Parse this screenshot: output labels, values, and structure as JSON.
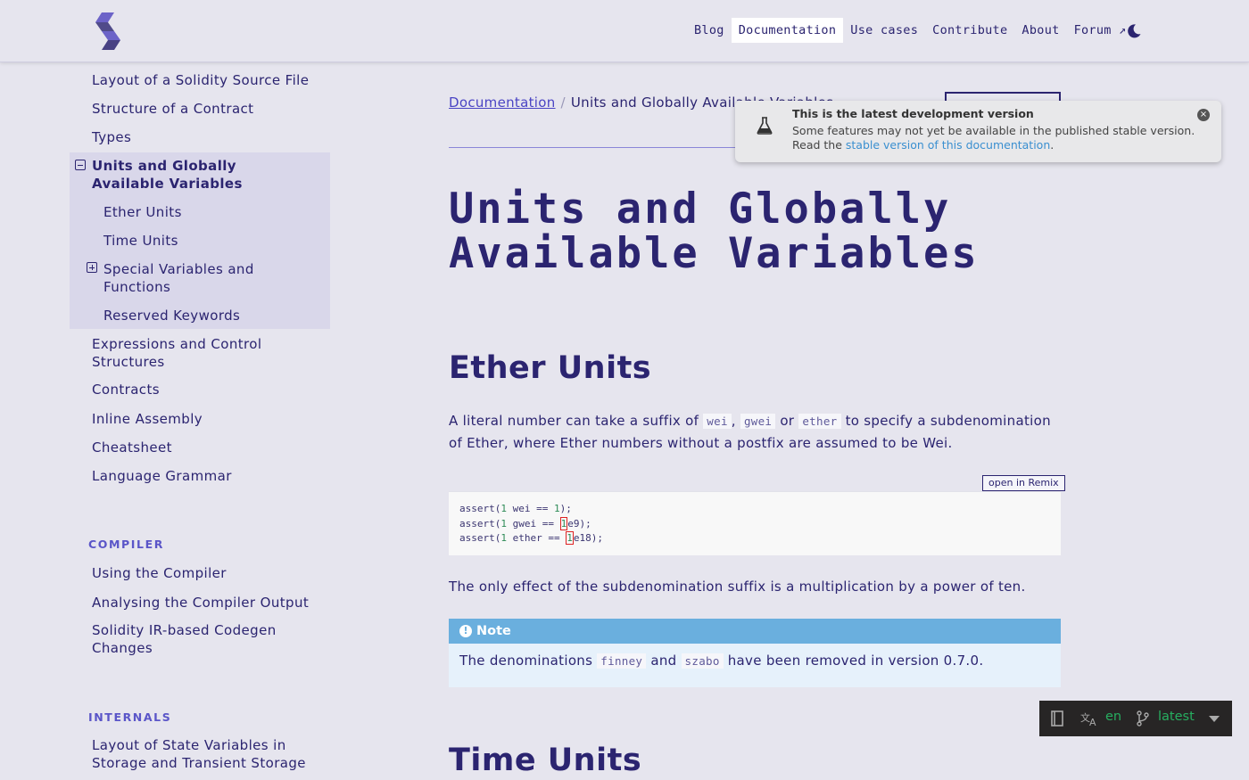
{
  "header": {
    "nav": [
      "Blog",
      "Documentation",
      "Use cases",
      "Contribute",
      "About",
      "Forum ↗"
    ],
    "active_nav": "Documentation"
  },
  "sidebar": {
    "items_top": [
      "Layout of a Solidity Source File",
      "Structure of a Contract",
      "Types"
    ],
    "current": "Units and Globally Available Variables",
    "sub_items": [
      "Ether Units",
      "Time Units",
      "Special Variables and Functions",
      "Reserved Keywords"
    ],
    "items_mid": [
      "Expressions and Control Structures",
      "Contracts",
      "Inline Assembly",
      "Cheatsheet",
      "Language Grammar"
    ],
    "caption_compiler": "COMPILER",
    "compiler_items": [
      "Using the Compiler",
      "Analysing the Compiler Output",
      "Solidity IR-based Codegen Changes"
    ],
    "caption_internals": "INTERNALS",
    "internals_items": [
      "Layout of State Variables in Storage and Transient Storage"
    ]
  },
  "breadcrumb": {
    "root": "Documentation",
    "separator": "/",
    "current": "Units and Globally Available Variables"
  },
  "page": {
    "title": "Units and Globally Available Variables",
    "section1_title": "Ether Units",
    "para1_a": "A literal number can take a suffix of ",
    "code_wei": "wei",
    "sep_comma": ",",
    "code_gwei": "gwei",
    "word_or": "or",
    "code_ether": "ether",
    "para1_b": " to specify a subdenomination of Ether, where Ether numbers without a postfix are assumed to be Wei.",
    "remix_label": "open in Remix",
    "code_lines": [
      "assert(1 wei == 1);",
      "assert(1 gwei == 1e9);",
      "assert(1 ether == 1e18);"
    ],
    "para2": "The only effect of the subdenomination suffix is a multiplication by a power of ten.",
    "note_title": "Note",
    "note_a": "The denominations ",
    "note_code1": "finney",
    "note_and": "and",
    "note_code2": "szabo",
    "note_b": " have been removed in version 0.7.0.",
    "section2_title": "Time Units"
  },
  "notification": {
    "title": "This is the latest development version",
    "line1": "Some features may not yet be available in the published stable version.",
    "line2_a": "Read the ",
    "link": "stable version of this documentation",
    "line2_b": "."
  },
  "flyout": {
    "language": "en",
    "version": "latest"
  },
  "colors": {
    "background": "#e6e5ee",
    "primary_text": "#2b2470",
    "link": "#4a44c4",
    "note_header": "#6aafde",
    "flyout_bg": "#272525",
    "flyout_accent": "#27ae60"
  }
}
